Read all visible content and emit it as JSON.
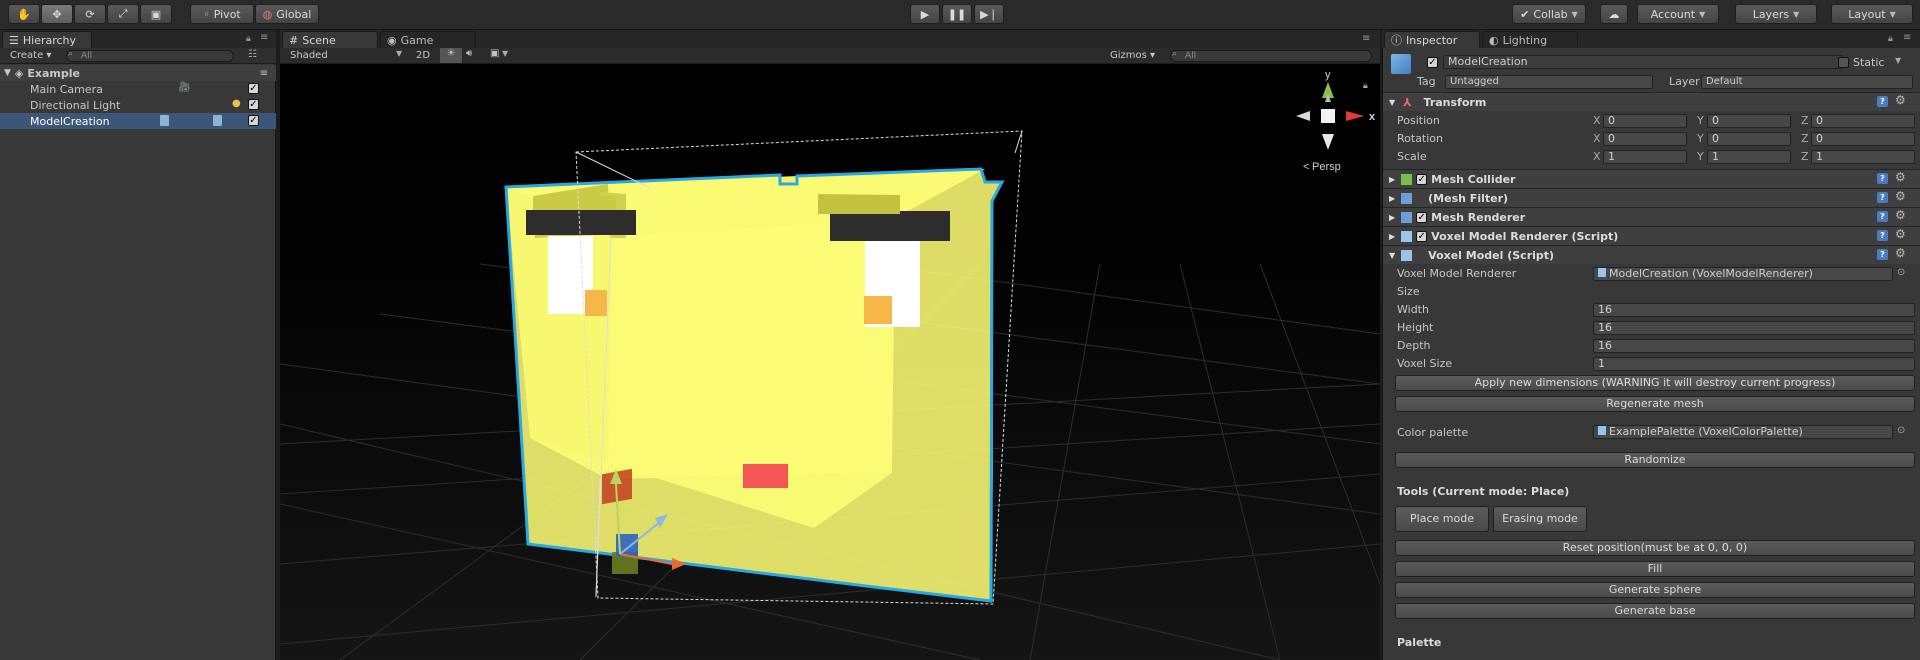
{
  "toolbar": {
    "pivot": "Pivot",
    "global": "Global",
    "collab": "Collab",
    "account": "Account",
    "layers": "Layers",
    "layout": "Layout",
    "tools": [
      "hand-icon",
      "move-icon",
      "rotate-icon",
      "scale-icon",
      "rect-icon"
    ]
  },
  "hierarchy": {
    "tab": "Hierarchy",
    "create": "Create",
    "search_placeholder": "All",
    "scene_name": "Example",
    "items": [
      {
        "label": "Main Camera"
      },
      {
        "label": "Directional Light"
      },
      {
        "label": "ModelCreation"
      }
    ]
  },
  "scene": {
    "tab_scene": "Scene",
    "tab_game": "Game",
    "shading": "Shaded",
    "mode_2d": "2D",
    "gizmos": "Gizmos",
    "search_placeholder": "All",
    "persp": "Persp",
    "axis_y": "y",
    "axis_x": "x"
  },
  "inspector": {
    "tab_inspector": "Inspector",
    "tab_lighting": "Lighting",
    "object_name": "ModelCreation",
    "static_label": "Static",
    "tag_label": "Tag",
    "tag_value": "Untagged",
    "layer_label": "Layer",
    "layer_value": "Default",
    "transform": {
      "title": "Transform",
      "position_label": "Position",
      "rotation_label": "Rotation",
      "scale_label": "Scale",
      "position": [
        "0",
        "0",
        "0"
      ],
      "rotation": [
        "0",
        "0",
        "0"
      ],
      "scale": [
        "1",
        "1",
        "1"
      ]
    },
    "components": [
      {
        "title": "Mesh Collider"
      },
      {
        "title": "(Mesh Filter)"
      },
      {
        "title": "Mesh Renderer"
      },
      {
        "title": "Voxel Model Renderer (Script)"
      },
      {
        "title": "Voxel Model (Script)"
      }
    ],
    "voxel": {
      "renderer_label": "Voxel Model Renderer",
      "renderer_value": "ModelCreation (VoxelModelRenderer)",
      "size_label": "Size",
      "width_label": "Width",
      "width": "16",
      "height_label": "Height",
      "height": "16",
      "depth_label": "Depth",
      "depth": "16",
      "voxel_size_label": "Voxel Size",
      "voxel_size": "1",
      "apply_button": "Apply new dimensions (WARNING it will destroy current progress)",
      "regenerate_button": "Regenerate mesh",
      "palette_label": "Color palette",
      "palette_value": "ExamplePalette (VoxelColorPalette)",
      "randomize_button": "Randomize",
      "tools_heading": "Tools (Current mode: Place)",
      "place_button": "Place mode",
      "erase_button": "Erasing mode",
      "reset_button": "Reset position(must be at 0, 0, 0)",
      "fill_button": "Fill",
      "sphere_button": "Generate sphere",
      "base_button": "Generate base",
      "palette_heading": "Palette"
    }
  }
}
